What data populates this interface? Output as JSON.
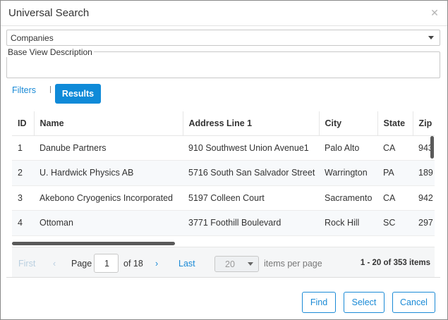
{
  "dialog": {
    "title": "Universal Search",
    "close_icon": "close-icon"
  },
  "entity_select": {
    "value": "Companies"
  },
  "description": {
    "legend": "Base View Description",
    "value": ""
  },
  "tabs": {
    "filters": "Filters",
    "results": "Results"
  },
  "grid": {
    "columns": [
      "ID",
      "Name",
      "Address Line 1",
      "City",
      "State",
      "Zip"
    ],
    "rows": [
      [
        "1",
        "Danube Partners",
        "910 Southwest Union Avenue1",
        "Palo Alto",
        "CA",
        "943"
      ],
      [
        "2",
        "U. Hardwick Physics AB",
        "5716 South San Salvador Street",
        "Warrington",
        "PA",
        "189"
      ],
      [
        "3",
        "Akebono Cryogenics Incorporated",
        "5197 Colleen Court",
        "Sacramento",
        "CA",
        "942"
      ],
      [
        "4",
        "Ottoman",
        "3771 Foothill Boulevard",
        "Rock Hill",
        "SC",
        "297"
      ]
    ]
  },
  "pager": {
    "first": "First",
    "prev_icon": "chevron-left-icon",
    "page_label": "Page",
    "page_value": "1",
    "of_label": "of 18",
    "next_icon": "chevron-right-icon",
    "last": "Last",
    "page_size": "20",
    "items_per_page": "items per page",
    "summary": "1 - 20 of 353 items"
  },
  "buttons": {
    "find": "Find",
    "select": "Select",
    "cancel": "Cancel"
  },
  "colors": {
    "accent": "#0f8ad8",
    "link": "#1a8ad6"
  }
}
